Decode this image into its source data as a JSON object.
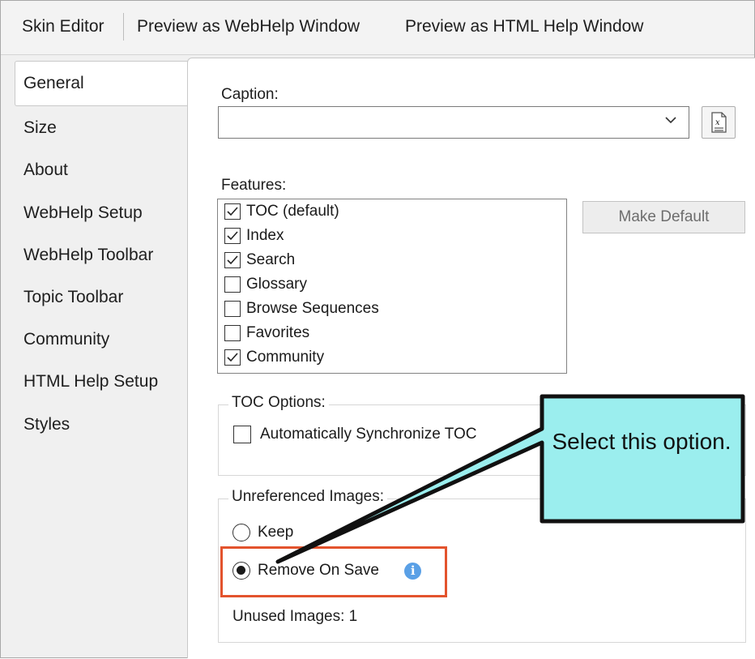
{
  "toolbar": {
    "skin_editor": "Skin Editor",
    "preview_webhelp": "Preview as WebHelp Window",
    "preview_htmlhelp": "Preview as HTML Help Window"
  },
  "tabs": [
    {
      "label": "General",
      "selected": true
    },
    {
      "label": "Size"
    },
    {
      "label": "About"
    },
    {
      "label": "WebHelp Setup"
    },
    {
      "label": "WebHelp Toolbar"
    },
    {
      "label": "Topic Toolbar"
    },
    {
      "label": "Community"
    },
    {
      "label": "HTML Help Setup"
    },
    {
      "label": "Styles"
    }
  ],
  "general": {
    "caption_label": "Caption:",
    "caption_value": "",
    "features_label": "Features:",
    "features": [
      {
        "label": "TOC (default)",
        "checked": true
      },
      {
        "label": "Index",
        "checked": true
      },
      {
        "label": "Search",
        "checked": true
      },
      {
        "label": "Glossary",
        "checked": false
      },
      {
        "label": "Browse Sequences",
        "checked": false
      },
      {
        "label": "Favorites",
        "checked": false
      },
      {
        "label": "Community",
        "checked": true
      }
    ],
    "make_default": "Make Default",
    "toc_options_title": "TOC Options:",
    "auto_sync_toc": "Automatically Synchronize TOC",
    "unreferenced_title": "Unreferenced Images:",
    "keep": "Keep",
    "remove_on_save": "Remove On Save",
    "unused_images": "Unused Images: 1"
  },
  "callout": {
    "text": "Select this option.",
    "fill": "#9beeee",
    "highlight_color": "#e3532d"
  }
}
